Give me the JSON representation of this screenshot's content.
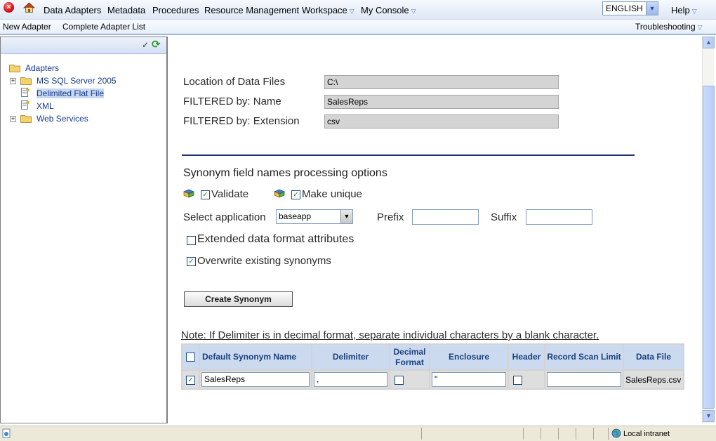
{
  "menubar": {
    "items": [
      "Data Adapters",
      "Metadata",
      "Procedures",
      "Resource Management",
      "Workspace",
      "My Console"
    ],
    "language": "ENGLISH",
    "help": "Help"
  },
  "toolbar2": {
    "new_adapter": "New Adapter",
    "complete_list": "Complete Adapter List",
    "troubleshooting": "Troubleshooting"
  },
  "tree": {
    "root": "Adapters",
    "items": [
      "MS SQL Server 2005",
      "Delimited Flat File",
      "XML",
      "Web Services"
    ]
  },
  "form": {
    "location_label": "Location of Data Files",
    "location_value": "C:\\",
    "filter_name_label": "FILTERED by: Name",
    "filter_name_value": "SalesReps",
    "filter_ext_label": "FILTERED by: Extension",
    "filter_ext_value": "csv",
    "section_title": "Synonym field names processing options",
    "validate_label": "Validate",
    "make_unique_label": "Make unique",
    "select_app_label": "Select application",
    "app_value": "baseapp",
    "prefix_label": "Prefix",
    "suffix_label": "Suffix",
    "extended_label": "Extended data format attributes",
    "overwrite_label": "Overwrite existing synonyms",
    "create_button": "Create Synonym",
    "note": "Note: If Delimiter is in decimal format, separate individual characters by a blank character."
  },
  "table": {
    "headers": [
      "Default Synonym Name",
      "Delimiter",
      "Decimal Format",
      "Enclosure",
      "Header",
      "Record Scan Limit",
      "Data File"
    ],
    "row": {
      "synonym_name": "SalesReps",
      "delimiter": ",",
      "enclosure": "\"",
      "data_file": "SalesReps.csv"
    }
  },
  "status": {
    "zone": "Local intranet"
  }
}
